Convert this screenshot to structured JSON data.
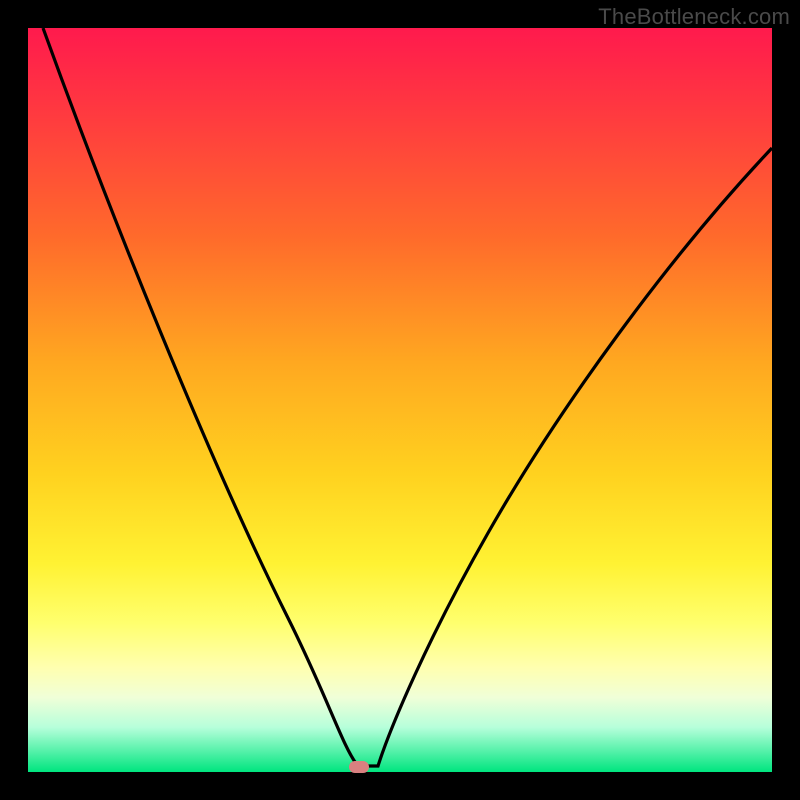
{
  "watermark": "TheBottleneck.com",
  "marker": {
    "x_pct": 44.5,
    "y_pct": 99.3
  },
  "chart_data": {
    "type": "line",
    "title": "",
    "xlabel": "",
    "ylabel": "",
    "xlim": [
      0,
      100
    ],
    "ylim": [
      0,
      100
    ],
    "grid": false,
    "legend": false,
    "series": [
      {
        "name": "bottleneck-curve",
        "x": [
          0,
          5,
          10,
          15,
          20,
          25,
          30,
          35,
          38,
          40,
          42,
          44.5,
          47,
          50,
          55,
          60,
          65,
          70,
          75,
          80,
          85,
          90,
          95,
          100
        ],
        "y": [
          100,
          92,
          83,
          73,
          62,
          50,
          37,
          22,
          13,
          7,
          2,
          0.3,
          3,
          10,
          23,
          34,
          44,
          53,
          61,
          68,
          74,
          79,
          83,
          86
        ]
      }
    ],
    "annotations": [
      {
        "type": "marker",
        "x": 44.5,
        "y": 0.3,
        "label": "optimal-point"
      }
    ],
    "background_gradient": {
      "direction": "vertical",
      "stops": [
        {
          "pos": 0.0,
          "color": "#ff1a4d"
        },
        {
          "pos": 0.5,
          "color": "#ffd21f"
        },
        {
          "pos": 0.88,
          "color": "#ffffb0"
        },
        {
          "pos": 1.0,
          "color": "#00e57f"
        }
      ]
    }
  }
}
